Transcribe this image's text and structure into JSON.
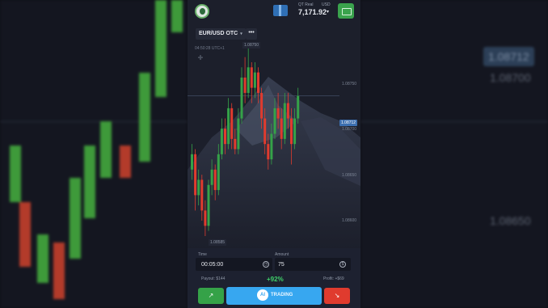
{
  "header": {
    "account_label": "QT Real",
    "currency_label": "USD",
    "balance": "7,171.92",
    "balance_caret": "▾"
  },
  "asset": {
    "pair": "EUR/USD OTC",
    "caret": "▾",
    "more": "•••"
  },
  "chart": {
    "time_label": "04:50:28 UTC+1",
    "high_label": "1.08750",
    "low_label": "1.08585",
    "current_price": "1.08712",
    "y_ticks": [
      "1.08750",
      "1.08700",
      "1.08650",
      "1.08600"
    ],
    "candles": [
      {
        "o": 1.0864,
        "c": 1.08655,
        "h": 1.08665,
        "l": 1.0863
      },
      {
        "o": 1.08655,
        "c": 1.08615,
        "h": 1.0866,
        "l": 1.086
      },
      {
        "o": 1.08615,
        "c": 1.0863,
        "h": 1.0864,
        "l": 1.08605
      },
      {
        "o": 1.0863,
        "c": 1.086,
        "h": 1.08635,
        "l": 1.0859
      },
      {
        "o": 1.086,
        "c": 1.08585,
        "h": 1.0861,
        "l": 1.08575
      },
      {
        "o": 1.08585,
        "c": 1.08625,
        "h": 1.0863,
        "l": 1.0858
      },
      {
        "o": 1.08625,
        "c": 1.0864,
        "h": 1.0865,
        "l": 1.08615
      },
      {
        "o": 1.0864,
        "c": 1.0862,
        "h": 1.08645,
        "l": 1.0861
      },
      {
        "o": 1.0862,
        "c": 1.08655,
        "h": 1.08665,
        "l": 1.08615
      },
      {
        "o": 1.08655,
        "c": 1.0868,
        "h": 1.0869,
        "l": 1.0865
      },
      {
        "o": 1.0868,
        "c": 1.08665,
        "h": 1.0869,
        "l": 1.08655
      },
      {
        "o": 1.08665,
        "c": 1.087,
        "h": 1.0871,
        "l": 1.0866
      },
      {
        "o": 1.087,
        "c": 1.0867,
        "h": 1.08705,
        "l": 1.0866
      },
      {
        "o": 1.0867,
        "c": 1.0866,
        "h": 1.0868,
        "l": 1.08655
      },
      {
        "o": 1.0866,
        "c": 1.0869,
        "h": 1.087,
        "l": 1.08655
      },
      {
        "o": 1.0869,
        "c": 1.0873,
        "h": 1.0874,
        "l": 1.08685
      },
      {
        "o": 1.0873,
        "c": 1.08715,
        "h": 1.0875,
        "l": 1.08705
      },
      {
        "o": 1.08715,
        "c": 1.0874,
        "h": 1.0876,
        "l": 1.0871
      },
      {
        "o": 1.0874,
        "c": 1.0872,
        "h": 1.08745,
        "l": 1.08705
      },
      {
        "o": 1.0872,
        "c": 1.08735,
        "h": 1.08745,
        "l": 1.0871
      },
      {
        "o": 1.08735,
        "c": 1.08715,
        "h": 1.0874,
        "l": 1.08705
      },
      {
        "o": 1.08715,
        "c": 1.0869,
        "h": 1.0872,
        "l": 1.0868
      },
      {
        "o": 1.0869,
        "c": 1.08665,
        "h": 1.087,
        "l": 1.08655
      },
      {
        "o": 1.08665,
        "c": 1.0865,
        "h": 1.08675,
        "l": 1.0864
      },
      {
        "o": 1.0865,
        "c": 1.08675,
        "h": 1.08685,
        "l": 1.08645
      },
      {
        "o": 1.08675,
        "c": 1.087,
        "h": 1.0871,
        "l": 1.0867
      },
      {
        "o": 1.087,
        "c": 1.0869,
        "h": 1.08715,
        "l": 1.0868
      },
      {
        "o": 1.0869,
        "c": 1.0867,
        "h": 1.087,
        "l": 1.0866
      },
      {
        "o": 1.0867,
        "c": 1.08705,
        "h": 1.08715,
        "l": 1.08665
      },
      {
        "o": 1.08705,
        "c": 1.0869,
        "h": 1.08715,
        "l": 1.0868
      },
      {
        "o": 1.0869,
        "c": 1.08665,
        "h": 1.087,
        "l": 1.08645
      },
      {
        "o": 1.08665,
        "c": 1.0869,
        "h": 1.087,
        "l": 1.0866
      },
      {
        "o": 1.0869,
        "c": 1.08712,
        "h": 1.0872,
        "l": 1.08685
      }
    ]
  },
  "form": {
    "time_label": "Time",
    "time_value": "00:05:00",
    "amount_label": "Amount",
    "amount_value": "75",
    "currency_symbol": "$",
    "payout_text": "Payout: $144",
    "payout_percent": "+92%",
    "profit_text": "Profit: +$69"
  },
  "buttons": {
    "up_arrow": "↗",
    "ai_badge": "AI",
    "ai_label": "TRADING",
    "down_arrow": "↘"
  },
  "background": {
    "side_price_hi": "1.08712",
    "side_price_mid": "1.08700",
    "side_price_lo": "1.08650"
  },
  "colors": {
    "up": "#35a248",
    "down": "#e03b2e",
    "accent": "#37a7f0"
  }
}
